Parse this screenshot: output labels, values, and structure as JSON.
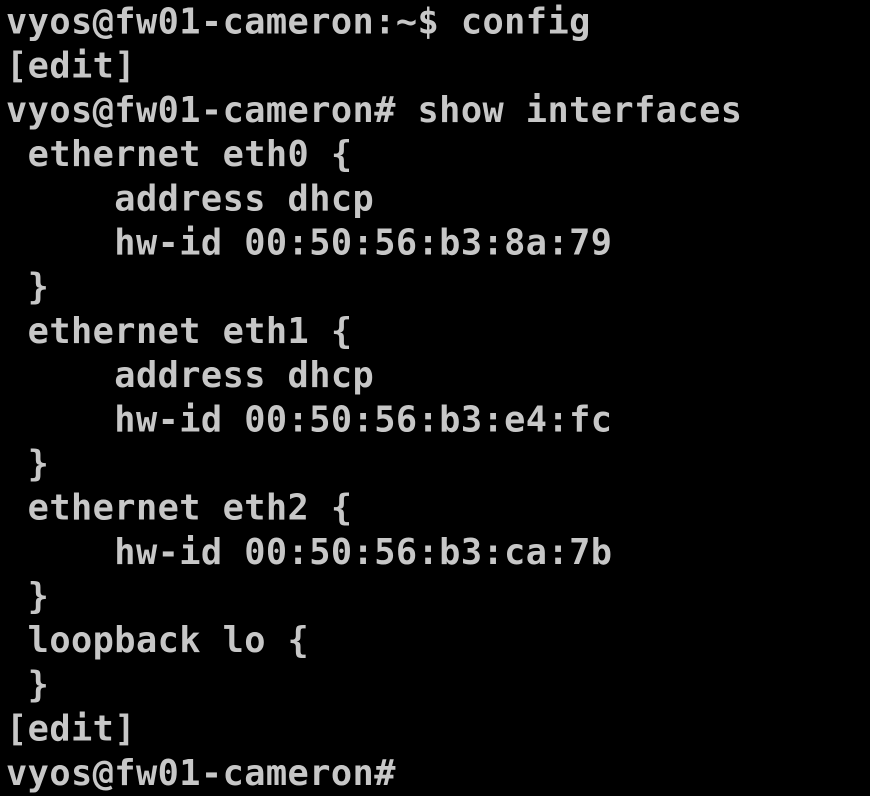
{
  "terminal": {
    "lines": [
      "vyos@fw01-cameron:~$ config",
      "[edit]",
      "vyos@fw01-cameron# show interfaces",
      " ethernet eth0 {",
      "     address dhcp",
      "     hw-id 00:50:56:b3:8a:79",
      " }",
      " ethernet eth1 {",
      "     address dhcp",
      "     hw-id 00:50:56:b3:e4:fc",
      " }",
      " ethernet eth2 {",
      "     hw-id 00:50:56:b3:ca:7b",
      " }",
      " loopback lo {",
      " }",
      "[edit]",
      "vyos@fw01-cameron#"
    ]
  },
  "colors": {
    "background": "#000000",
    "foreground": "#c7c7c7"
  }
}
